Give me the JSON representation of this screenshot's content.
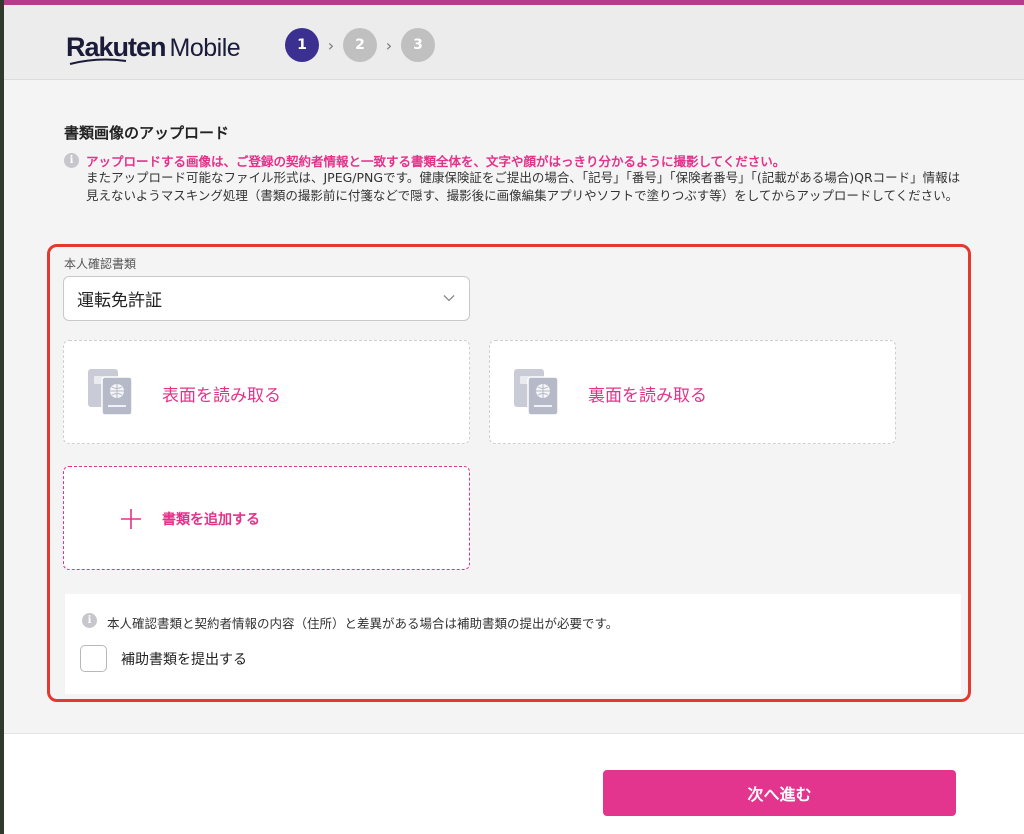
{
  "header": {
    "brand_main": "Rakuten",
    "brand_sub": "Mobile",
    "steps": [
      "1",
      "2",
      "3"
    ],
    "active_step": 1,
    "step_separator": "›"
  },
  "upload": {
    "title": "書類画像のアップロード",
    "notice_highlight": "アップロードする画像は、ご登録の契約者情報と一致する書類全体を、文字や顔がはっきり分かるように撮影してください。",
    "notice_body": "またアップロード可能なファイル形式は、JPEG/PNGです。健康保険証をご提出の場合、「記号」「番号」「保険者番号」「(記載がある場合)QRコード」情報は見えないようマスキング処理（書類の撮影前に付箋などで隠す、撮影後に画像編集アプリやソフトで塗りつぶす等）をしてからアップロードしてください。",
    "info_glyph": "i"
  },
  "document": {
    "label": "本人確認書類",
    "selected": "運転免許証",
    "front_label": "表面を読み取る",
    "back_label": "裏面を読み取る",
    "add_label": "書類を追加する"
  },
  "supplementary": {
    "notice": "本人確認書類と契約者情報の内容（住所）と差異がある場合は補助書類の提出が必要です。",
    "checkbox_label": "補助書類を提出する",
    "checked": false
  },
  "footer": {
    "next_label": "次へ進む"
  },
  "colors": {
    "accent": "#e4328a",
    "step_active": "#3b2f8f",
    "highlight_border": "#e23a2e"
  }
}
